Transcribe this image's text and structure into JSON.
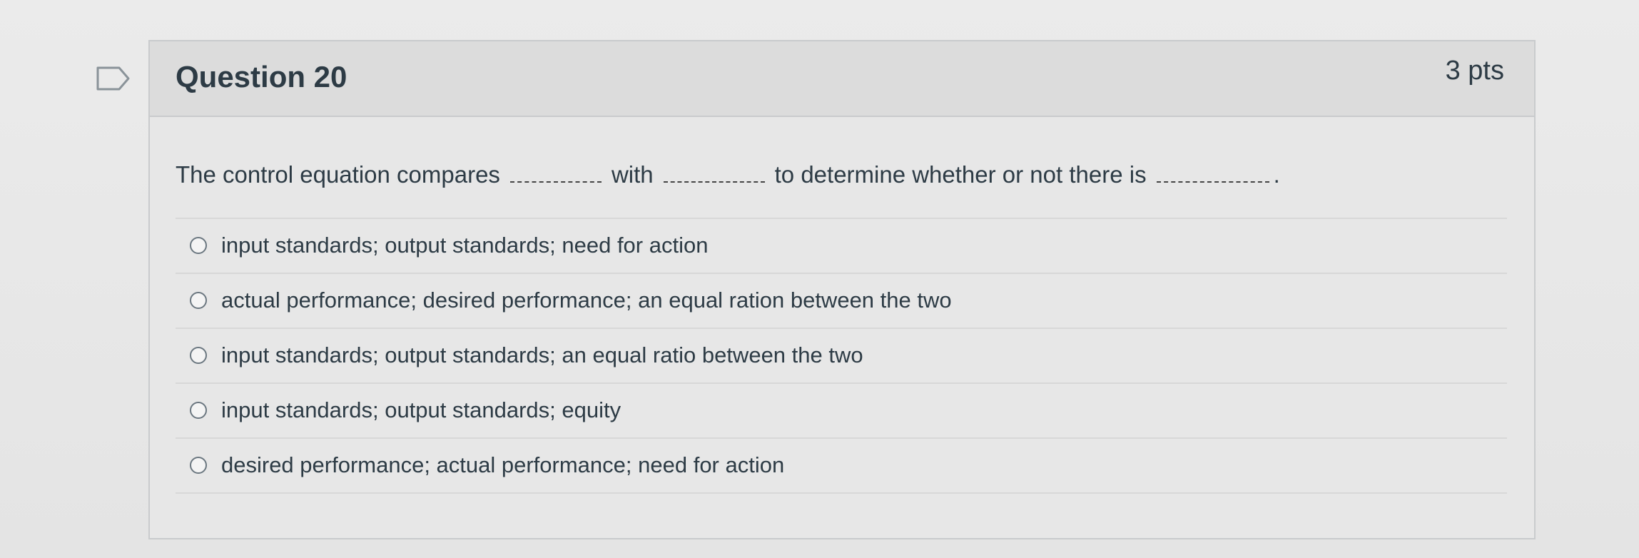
{
  "question": {
    "title": "Question 20",
    "points": "3 pts",
    "text_part1": "The control equation compares",
    "text_part2": "with",
    "text_part3": "to determine whether or not there is",
    "text_end": "."
  },
  "answers": [
    "input standards; output standards; need for action",
    "actual performance; desired performance; an equal ration between the two",
    "input standards; output standards; an equal ratio between the two",
    "input standards; output standards; equity",
    "desired performance; actual performance; need for action"
  ],
  "colors": {
    "text": "#2d3b45",
    "border": "#c9cbcd",
    "header_bg": "#dcdcdc"
  },
  "icons": {
    "flag": "flag-question-icon",
    "radio": "radio-unselected"
  }
}
